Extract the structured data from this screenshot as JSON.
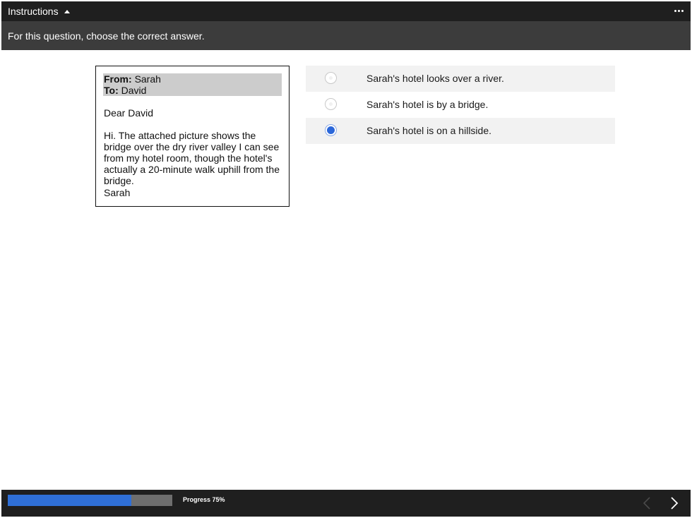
{
  "header": {
    "instructions_label": "Instructions",
    "instruction_text": "For this question, choose the correct answer."
  },
  "email": {
    "from_label": "From:",
    "from_value": "Sarah",
    "to_label": "To:",
    "to_value": "David",
    "greeting": "Dear David",
    "body": "Hi. The attached picture shows the bridge over the dry river valley I can see from my hotel room, though the hotel's actually a 20-minute walk uphill from the bridge.",
    "signature": "Sarah"
  },
  "options": [
    {
      "label": "Sarah's hotel looks over a river.",
      "selected": false
    },
    {
      "label": "Sarah's hotel is by a bridge.",
      "selected": false
    },
    {
      "label": "Sarah's hotel is on a hillside.",
      "selected": true
    }
  ],
  "footer": {
    "progress_text": "Progress 75%",
    "progress_value": 0.75
  },
  "colors": {
    "accent": "#2b67d9",
    "bar_dark": "#1f1f1f",
    "bar_mid": "#3c3c3c"
  },
  "icons": {
    "toggle": "caret-up-icon",
    "menu": "more-horizontal-icon",
    "prev": "chevron-left-icon",
    "next": "chevron-right-icon"
  }
}
